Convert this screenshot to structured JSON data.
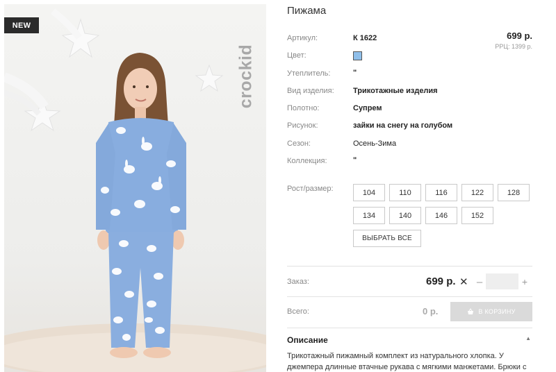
{
  "badge": "NEW",
  "brand_logo_text": "crockid",
  "product": {
    "title": "Пижама",
    "price": "699 р.",
    "rrp": "РРЦ: 1399 р.",
    "color_hex": "#8fbfea"
  },
  "attributes": [
    {
      "label": "Артикул:",
      "value": "К 1622"
    },
    {
      "label": "Цвет:",
      "value": ""
    },
    {
      "label": "Утеплитель:",
      "value": "\""
    },
    {
      "label": "Вид изделия:",
      "value": "Трикотажные изделия"
    },
    {
      "label": "Полотно:",
      "value": "Супрем"
    },
    {
      "label": "Рисунок:",
      "value": "зайки на снегу на голубом"
    },
    {
      "label": "Сезон:",
      "value": "Осень-Зима"
    },
    {
      "label": "Коллекция:",
      "value": "\""
    }
  ],
  "sizes": {
    "label": "Рост/размер:",
    "options": [
      "104",
      "110",
      "116",
      "122",
      "128",
      "134",
      "140",
      "146",
      "152"
    ],
    "select_all": "ВЫБРАТЬ ВСЕ"
  },
  "order": {
    "label": "Заказ:",
    "price": "699 р.",
    "times": "✕",
    "minus": "–",
    "plus": "+",
    "qty": ""
  },
  "total": {
    "label": "Всего:",
    "value": "0 р.",
    "cart_button": "В КОРЗИНУ"
  },
  "description": {
    "title": "Описание",
    "text": "Трикотажный пижамный комплект из натурального хлопка. У джемпера длинные втачные рукава с мягкими манжетами. Брюки с"
  }
}
